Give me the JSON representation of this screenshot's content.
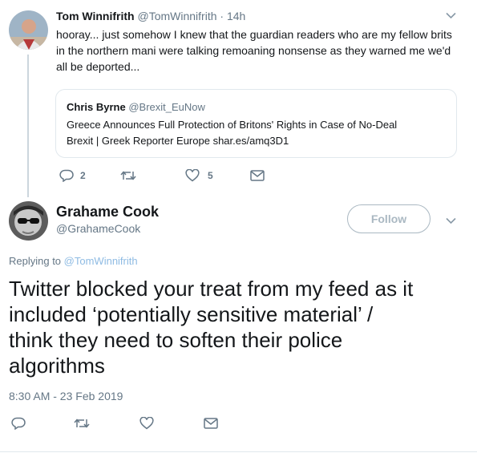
{
  "parent_tweet": {
    "author_name": "Tom Winnifrith",
    "handle": "@TomWinnifrith",
    "time": "· 14h",
    "text_lines": [
      "hooray... just somehow I knew that the guardian readers who are my fellow brits",
      "in the northern mani were talking remoaning nonsense as they warned me we'd",
      "all be deported..."
    ],
    "quote": {
      "author_name": "Chris Byrne",
      "handle": "@Brexit_EuNow",
      "text_lines": [
        "Greece Announces Full Protection of Britons' Rights in Case of No-Deal",
        "Brexit | Greek Reporter Europe shar.es/amq3D1"
      ]
    },
    "actions": {
      "replies": "2",
      "retweets": "",
      "likes": "5"
    }
  },
  "main_tweet": {
    "author_name": "Grahame Cook",
    "handle": "@GrahameCook",
    "follow_label": "Follow",
    "replying_prefix": "Replying to",
    "replying_handle": "@TomWinnifrith",
    "text_lines": [
      "Twitter blocked your treat from my feed as it",
      "included ‘potentially sensitive material’ /",
      "think they need to soften their police",
      "algorithms"
    ],
    "timestamp": "8:30 AM - 23 Feb 2019"
  },
  "colors": {
    "link_blue": "#1da1f2",
    "muted": "#657786",
    "thread_line": "#ccd6dd",
    "border": "#e1e8ed"
  }
}
